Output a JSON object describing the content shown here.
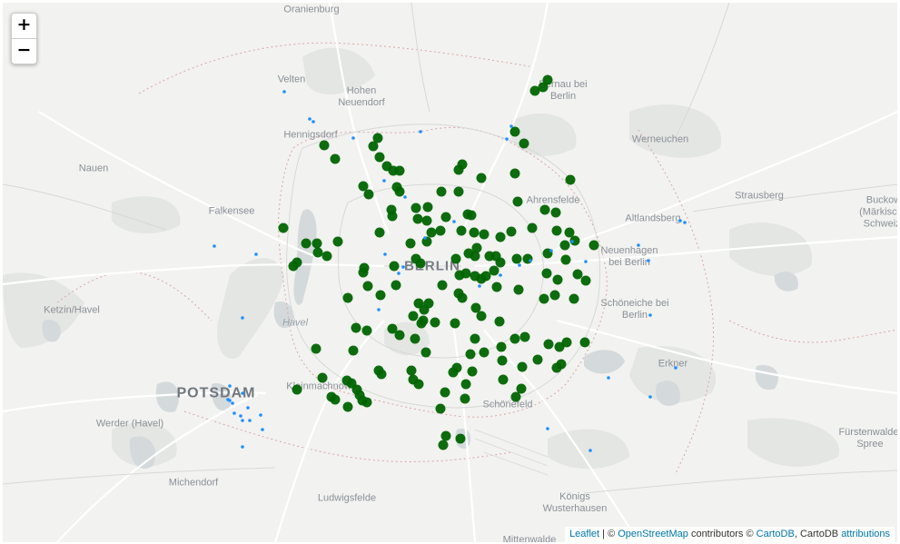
{
  "zoom": {
    "in_label": "+",
    "out_label": "−"
  },
  "attribution": {
    "leaflet": "Leaflet",
    "sep1": " | © ",
    "osm": "OpenStreetMap",
    "contrib": " contributors © ",
    "cartodb": "CartoDB",
    "sep2": ", CartoDB ",
    "attributions": "attributions"
  },
  "places": {
    "oranienburg": "Oranienburg",
    "bernau": "Bernau bei\nBerlin",
    "velten": "Velten",
    "hohen_neuendorf": "Hohen\nNeuendorf",
    "hennigsdorf": "Hennigsdorf",
    "werneuchen": "Werneuchen",
    "nauen": "Nauen",
    "strausberg": "Strausberg",
    "buckow": "Buckow\n(Märkische\nSchweiz)",
    "falkensee": "Falkensee",
    "ahrensfelde": "Ahrensfelde",
    "altlandsberg": "Altlandsberg",
    "neuenhagen": "Neuenhagen\nbei Berlin",
    "berlin": "BERLIN",
    "ketzin": "Ketzin/Havel",
    "havel": "Havel",
    "schoeneiche": "Schöneiche bei\nBerlin",
    "erkner": "Erkner",
    "potsdam": "POTSDAM",
    "kleinmachnow": "Kleinmachnow",
    "schoenefeld": "Schönefeld",
    "werder": "Werder (Havel)",
    "fuerstenwalde": "Fürstenwalde/\nSpree",
    "michendorf": "Michendorf",
    "ludwigsfelde": "Ludwigsfelde",
    "koenigs_wusterhausen": "Königs\nWusterhausen",
    "mittenwalde": "Mittenwalde"
  },
  "colors": {
    "station": "#006400",
    "blue_point": "#1e90ff"
  },
  "icons": {
    "zoom_in": "plus-icon",
    "zoom_out": "minus-icon"
  }
}
